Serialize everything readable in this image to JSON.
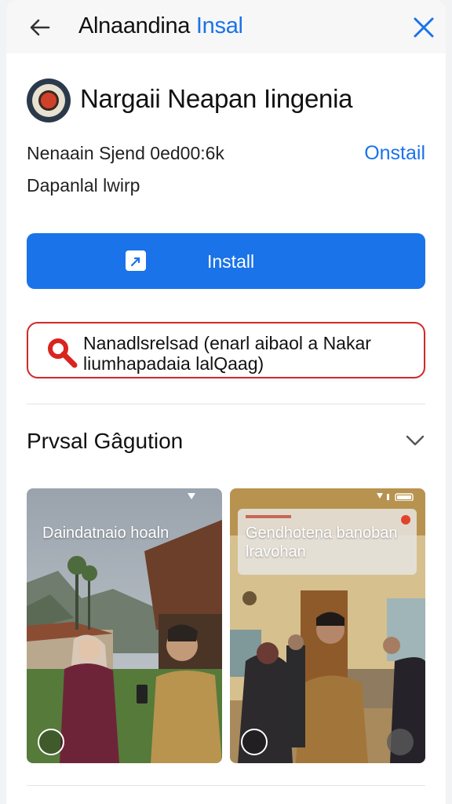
{
  "header": {
    "title_main": "Alnaandina",
    "title_accent": "Insal"
  },
  "app": {
    "name": "Nargaii Neapan Iingenia",
    "meta_line1": "Nenaain Sjend 0ed00:6k",
    "meta_link": "Onstail",
    "meta_line2": "Dapanlal lwirp"
  },
  "install_button": {
    "label": "Install"
  },
  "notice": {
    "line1": "Nanadlsrelsad (enarl aibaol a Nakar",
    "line2": "liumhapadaia lalQaag)"
  },
  "section": {
    "title": "Prvsal Gâgution"
  },
  "screenshots": [
    {
      "caption": "Daindatnaio hoaln"
    },
    {
      "caption_line1": "Gendhotena banoban",
      "caption_line2": "lravohan"
    }
  ],
  "colors": {
    "accent": "#1a73e8",
    "alert": "#d02a2a"
  },
  "icons": {
    "back": "arrow-left-icon",
    "close": "close-icon",
    "notice": "search-icon",
    "expand": "chevron-down-icon"
  }
}
